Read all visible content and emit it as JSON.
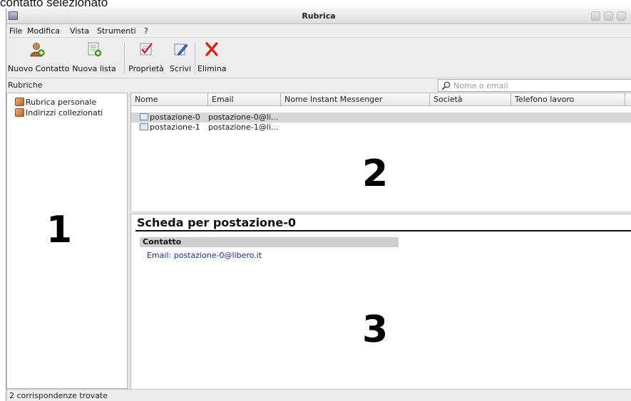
{
  "caption": "contatto selezionato",
  "window": {
    "title": "Rubrica"
  },
  "menu": {
    "file": "File",
    "modifica": "Modifica",
    "vista": "Vista",
    "strumenti": "Strumenti",
    "help": "?"
  },
  "toolbar": {
    "nuovo_contatto": "Nuovo Contatto",
    "nuova_lista": "Nuova lista",
    "proprieta": "Proprietà",
    "scrivi": "Scrivi",
    "elimina": "Elimina"
  },
  "subheader": {
    "rubriche_label": "Rubriche"
  },
  "search": {
    "placeholder": "Nome o email",
    "value": ""
  },
  "address_books": [
    {
      "label": "Rubrica personale"
    },
    {
      "label": "Indirizzi collezionati"
    }
  ],
  "columns": [
    {
      "label": "Nome"
    },
    {
      "label": "Email"
    },
    {
      "label": "Nome Instant Messenger"
    },
    {
      "label": "Società"
    },
    {
      "label": "Telefono lavoro"
    }
  ],
  "contacts": [
    {
      "name": "postazione-0",
      "email": "postazione-0@li...",
      "selected": true
    },
    {
      "name": "postazione-1",
      "email": "postazione-1@li...",
      "selected": false
    }
  ],
  "detail": {
    "title": "Scheda per postazione-0",
    "section_header": "Contatto",
    "email_line": "Email: postazione-0@libero.it"
  },
  "annotations": {
    "one": "1",
    "two": "2",
    "three": "3"
  },
  "status": {
    "text": "2 corrispondenze trovate"
  },
  "colors": {
    "selection": "#d6d6d6",
    "email_link": "#1b2e88",
    "delete_red": "#d9251b"
  }
}
